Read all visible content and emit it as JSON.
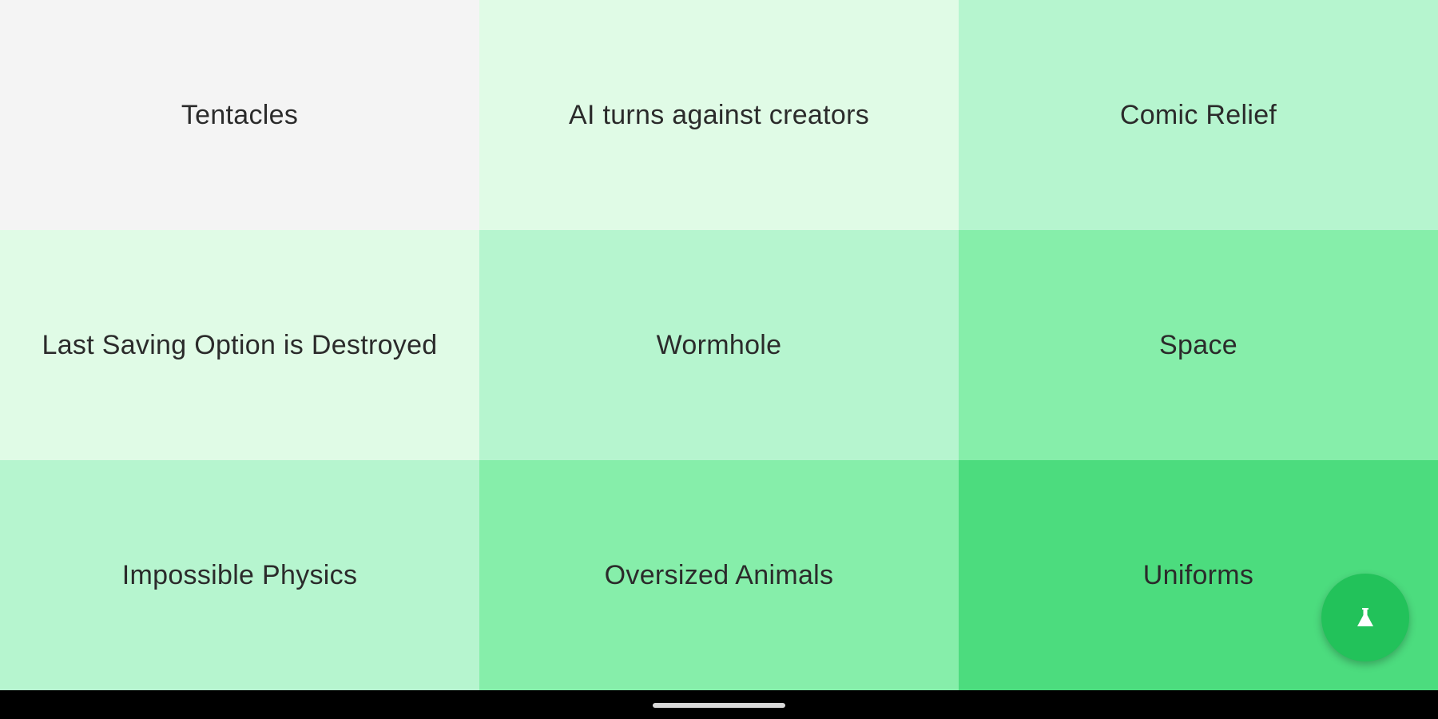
{
  "tiles": [
    {
      "label": "Tentacles",
      "color": "#f4f4f4"
    },
    {
      "label": "AI turns against creators",
      "color": "#e0fbe6"
    },
    {
      "label": "Comic Relief",
      "color": "#b6f5cf"
    },
    {
      "label": "Last Saving Option is Destroyed",
      "color": "#e0fbe6"
    },
    {
      "label": "Wormhole",
      "color": "#b6f5cf"
    },
    {
      "label": "Space",
      "color": "#86eeaa"
    },
    {
      "label": "Impossible Physics",
      "color": "#b6f5cf"
    },
    {
      "label": "Oversized Animals",
      "color": "#86eeaa"
    },
    {
      "label": "Uniforms",
      "color": "#4cdc7e"
    }
  ],
  "fab": {
    "icon": "flask-icon",
    "color": "#22c25a",
    "icon_color": "#ffffff"
  }
}
